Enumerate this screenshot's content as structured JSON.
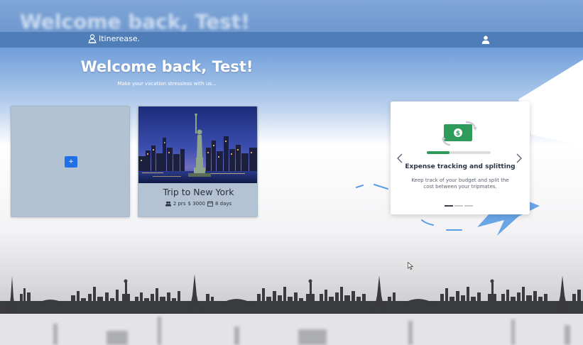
{
  "background": {
    "ghost_title": "Welcome back, Test!"
  },
  "navbar": {
    "brand": "Itinerease.",
    "brand_icon": "user-pin-icon",
    "user_icon": "user-icon"
  },
  "hero": {
    "title": "Welcome back, Test!",
    "subtitle": "Make your vacation stressless with us..."
  },
  "add_card": {
    "button_label": "+"
  },
  "trip_card": {
    "title": "Trip to New York",
    "people": "2 prs",
    "budget": "$ 3000",
    "days": "8 days"
  },
  "carousel": {
    "title": "Expense tracking and splitting",
    "description": "Keep track of your budget and split the cost between your tripmates.",
    "progress": 0.36,
    "slides": 3,
    "active_slide": 0,
    "icons": [
      "money-exchange-icon",
      "chevron-left-icon",
      "chevron-right-icon"
    ]
  },
  "colors": {
    "navbar": "#4f7db7",
    "accent": "#1f6fe6",
    "money_green": "#2f9b5a",
    "card": "#b3c2d2"
  }
}
